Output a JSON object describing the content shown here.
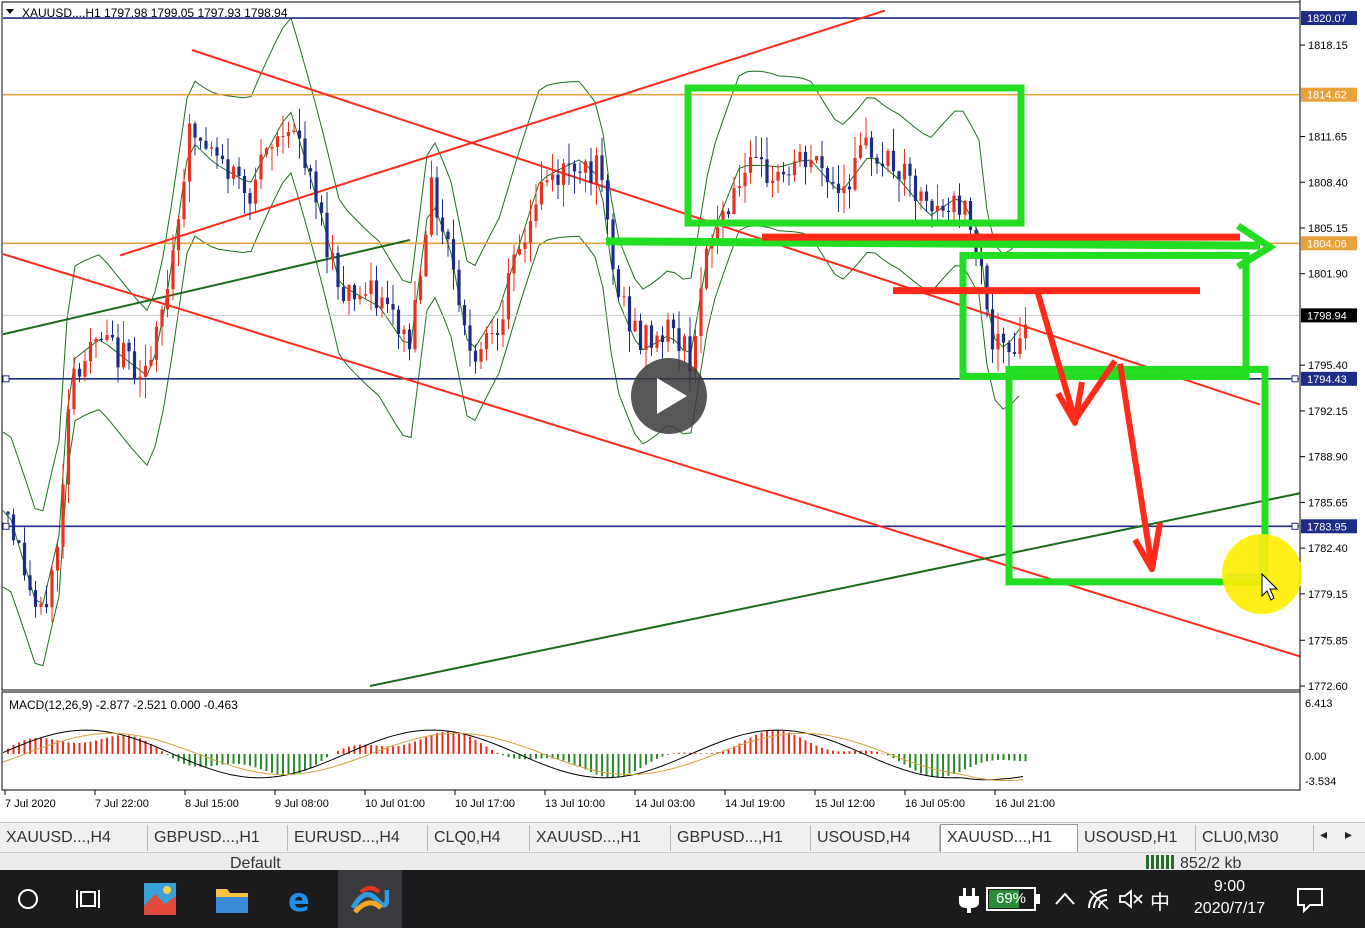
{
  "chart": {
    "header": "XAUUSD...,H1  1797.98 1799.05 1797.93 1798.94",
    "price_axis": {
      "min": 1772.6,
      "max": 1820.5,
      "ticks": [
        1818.15,
        1811.65,
        1808.4,
        1805.15,
        1801.9,
        1795.4,
        1792.15,
        1788.9,
        1785.65,
        1782.4,
        1779.15,
        1775.85,
        1772.6
      ],
      "badges": [
        {
          "value": "1820.07",
          "price": 1820.07,
          "bg": "#1c2c87",
          "fg": "#ffffff"
        },
        {
          "value": "1814.62",
          "price": 1814.62,
          "bg": "#e8a23a",
          "fg": "#ffffff"
        },
        {
          "value": "1804.06",
          "price": 1804.06,
          "bg": "#e8a23a",
          "fg": "#ffffff"
        },
        {
          "value": "1798.94",
          "price": 1798.94,
          "bg": "#000000",
          "fg": "#ffffff"
        },
        {
          "value": "1794.43",
          "price": 1794.43,
          "bg": "#1c2c87",
          "fg": "#ffffff"
        },
        {
          "value": "1783.95",
          "price": 1783.95,
          "bg": "#1c2c87",
          "fg": "#ffffff"
        }
      ]
    },
    "time_axis": [
      "7 Jul 2020",
      "7 Jul 22:00",
      "8 Jul 15:00",
      "9 Jul 08:00",
      "10 Jul 01:00",
      "10 Jul 17:00",
      "13 Jul 10:00",
      "14 Jul 03:00",
      "14 Jul 19:00",
      "15 Jul 12:00",
      "16 Jul 05:00",
      "16 Jul 21:00"
    ],
    "colors": {
      "bull": "#e8311f",
      "bear": "#1c2c87",
      "trend": "#ff2a1a",
      "support": "#1a6b1a",
      "hline_orange": "#e8a23a",
      "hline_blue": "#1c2c87",
      "bands": "#1f6e1f",
      "annot_green": "#22dd22",
      "annot_red": "#ff2a1a"
    },
    "macd": {
      "label": "MACD(12,26,9) -2.877 -2.521 0.000 -0.463",
      "scale_max": "6.413",
      "scale_zero": "0.00",
      "scale_min": "-3.534",
      "max": 6.413,
      "min": -3.534
    },
    "play_button_icon": "play-icon"
  },
  "tabs": {
    "items": [
      "XAUUSD...,H4",
      "GBPUSD...,H1",
      "EURUSD...,H4",
      "CLQ0,H4",
      "XAUUSD...,H1",
      "GBPUSD...,H1",
      "USOUSD,H4",
      "XAUUSD...,H1",
      "USOUSD,H1",
      "CLU0,M30"
    ],
    "active_index": 7,
    "prev_icon": "◂",
    "next_icon": "▸"
  },
  "status": {
    "profile": "Default",
    "traffic": "852/2 kb"
  },
  "taskbar": {
    "battery": "69%",
    "battery_level": 0.69,
    "time": "9:00",
    "date": "2020/7/17",
    "ime": "中",
    "apps": [
      "cortana-icon",
      "task-view-icon",
      "photos-icon",
      "file-explorer-icon",
      "edge-icon",
      "metatrader-icon"
    ]
  }
}
